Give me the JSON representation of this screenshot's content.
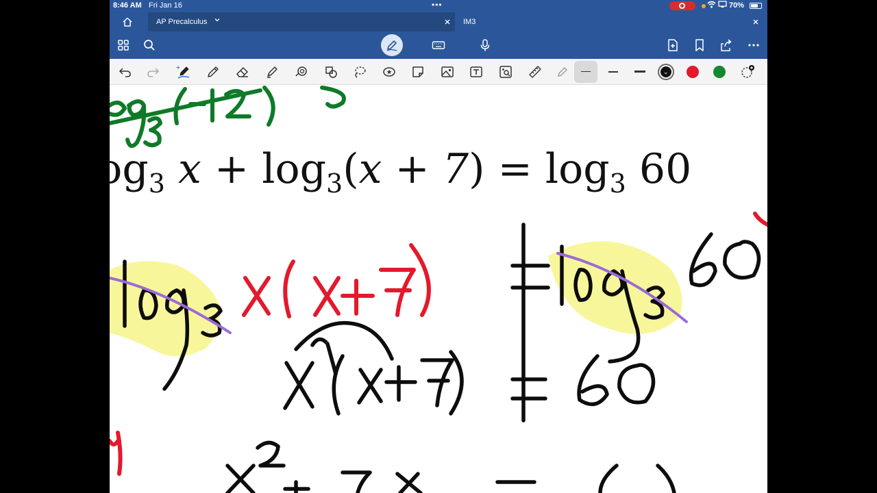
{
  "status_bar": {
    "time": "8:46 AM",
    "date": "Fri Jan 16",
    "battery_percent": "70%",
    "battery_level": 0.7,
    "recording": true
  },
  "tabs": [
    {
      "label": "AP Precalculus",
      "active": true
    },
    {
      "label": "IM3",
      "active": false
    }
  ],
  "menu_bar": {
    "left_icons": [
      "grid-icon",
      "search-icon"
    ],
    "center_icons": [
      "draw-pen-icon",
      "keyboard-icon",
      "microphone-icon"
    ],
    "right_icons": [
      "new-page-icon",
      "bookmark-icon",
      "share-icon",
      "more-icon"
    ]
  },
  "toolbar": {
    "tools": [
      "undo-icon",
      "redo-icon",
      "ink-to-text-pen-icon",
      "pen-icon",
      "eraser-icon",
      "highlighter-icon",
      "lasso-shape-icon",
      "shapes-icon",
      "lasso-select-icon",
      "sticker-icon",
      "sticky-note-icon",
      "image-icon",
      "text-box-icon",
      "image-search-icon",
      "ruler-icon",
      "pencil-icon"
    ],
    "pen_widths": [
      "thin",
      "medium",
      "thick"
    ],
    "colors": [
      {
        "name": "black",
        "hex": "#111111",
        "selected": true
      },
      {
        "name": "red",
        "hex": "#e3192d",
        "selected": false
      },
      {
        "name": "green",
        "hex": "#0f8a2f",
        "selected": false
      }
    ]
  },
  "canvas": {
    "equation": {
      "fn": "log",
      "base": "3",
      "var": "x",
      "plus": "+",
      "open": "(",
      "inner": "x + 7",
      "close": ")",
      "eq": "=",
      "value": "60"
    },
    "ink_colors": {
      "black": "#0d0d0d",
      "red": "#e3192d",
      "green": "#0f7a28",
      "purple": "#9b6bd6",
      "highlight": "#f6f37a"
    }
  }
}
